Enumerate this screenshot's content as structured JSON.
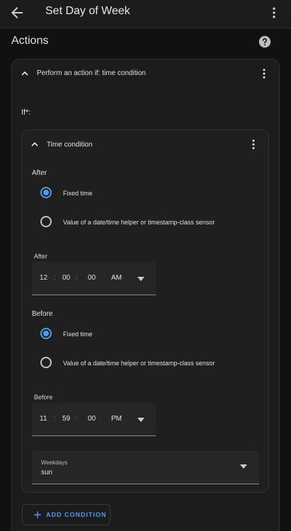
{
  "appbar": {
    "title": "Set Day of Week",
    "back_icon": "arrow-left-icon",
    "menu_icon": "dots-vertical-icon"
  },
  "section": {
    "title": "Actions",
    "help_icon": "help-circle-icon"
  },
  "action_card": {
    "title": "Perform an action if: time condition"
  },
  "if_label": "If*:",
  "condition_card": {
    "title": "Time condition"
  },
  "after": {
    "group_label": "After",
    "options": [
      {
        "label": "Fixed time",
        "checked": true
      },
      {
        "label": "Value of a date/time helper or timestamp-class sensor",
        "checked": false
      }
    ],
    "picker": {
      "caption": "After",
      "hours": "12",
      "minutes": "00",
      "seconds": "00",
      "ampm": "AM",
      "separator": ":"
    }
  },
  "before": {
    "group_label": "Before",
    "options": [
      {
        "label": "Fixed time",
        "checked": true
      },
      {
        "label": "Value of a date/time helper or timestamp-class sensor",
        "checked": false
      }
    ],
    "picker": {
      "caption": "Before",
      "hours": "11",
      "minutes": "59",
      "seconds": "00",
      "ampm": "PM",
      "separator": ":"
    }
  },
  "weekdays": {
    "caption": "Weekdays",
    "value": "sun"
  },
  "add_condition": {
    "label": "ADD CONDITION"
  },
  "colors": {
    "accent": "#4f9be8",
    "background": "#111111",
    "surface": "#1c1c1c"
  }
}
